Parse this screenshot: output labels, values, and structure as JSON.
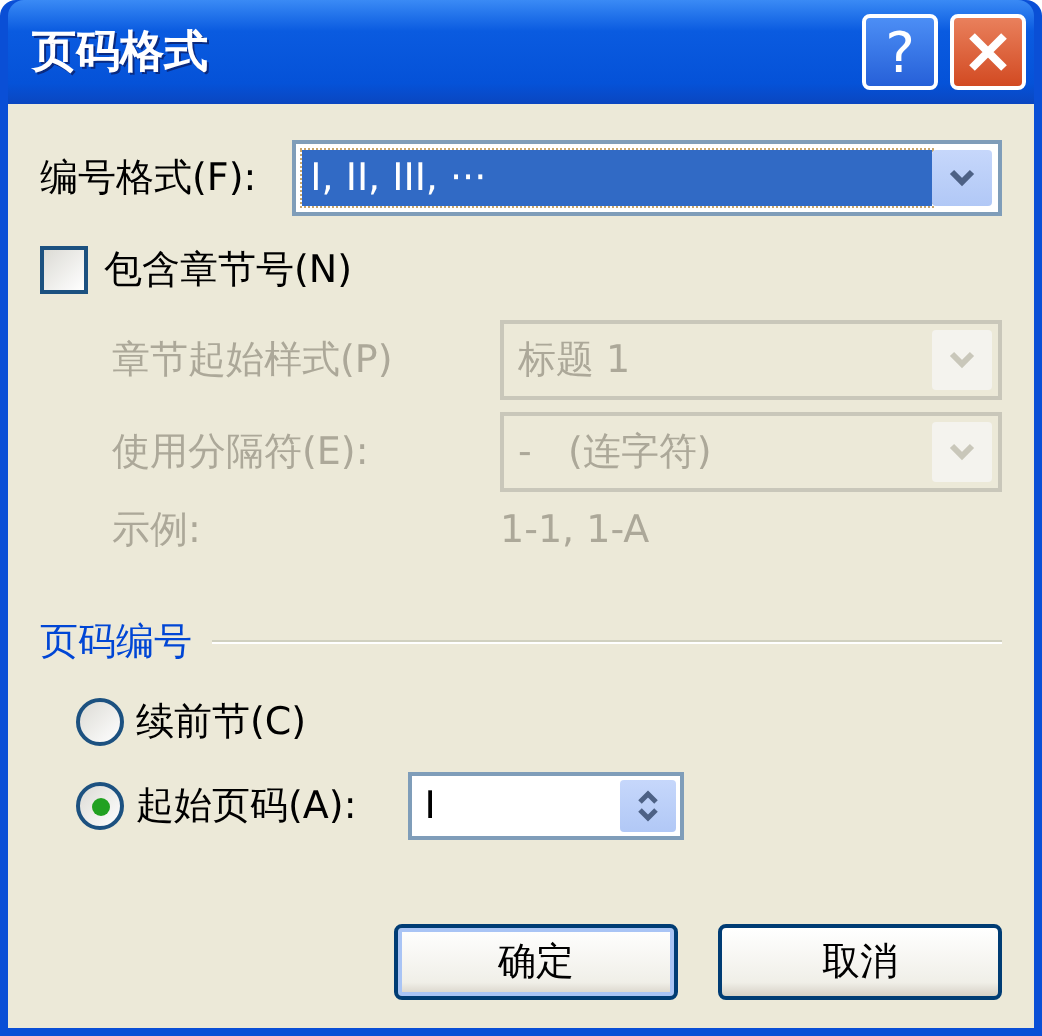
{
  "window": {
    "title": "页码格式",
    "help": "?"
  },
  "number_format": {
    "label": "编号格式(F):",
    "value": "I, II, III, ···",
    "selected": true
  },
  "include_chapter": {
    "label": "包含章节号(N)",
    "checked": false
  },
  "chapter_rows": [
    {
      "kind": "combo",
      "label": "章节起始样式(P)",
      "value": "标题 1",
      "disabled": true
    },
    {
      "kind": "combo",
      "label": "使用分隔符(E):",
      "value": "-   (连字符)",
      "disabled": true
    },
    {
      "kind": "text",
      "label": "示例:",
      "value": "1-1, 1-A",
      "disabled": true
    }
  ],
  "page_numbering": {
    "title": "页码编号",
    "options": [
      {
        "label": "续前节(C)",
        "selected": false
      },
      {
        "label": "起始页码(A):",
        "selected": true
      }
    ],
    "start_at": {
      "value": "I"
    }
  },
  "buttons": [
    {
      "label": "确定",
      "default": true
    },
    {
      "label": "取消",
      "default": false
    }
  ]
}
